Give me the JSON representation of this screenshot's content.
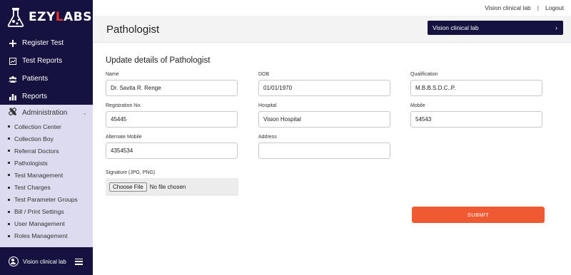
{
  "app": {
    "brand_prefix": "EZY",
    "brand_accent": "L",
    "brand_suffix": "ABS"
  },
  "sidebar": {
    "items": [
      {
        "label": "Register Test",
        "icon": "plus-icon"
      },
      {
        "label": "Test Reports",
        "icon": "report-icon"
      },
      {
        "label": "Patients",
        "icon": "users-icon"
      },
      {
        "label": "Reports",
        "icon": "bar-chart-icon"
      }
    ],
    "admin": {
      "label": "Administration",
      "icon": "tools-icon",
      "items": [
        "Collection Center",
        "Collection Boy",
        "Referral Doctors",
        "Pathologists",
        "Test Management",
        "Test Charges",
        "Test Parameter Groups",
        "Bill / Print Settings",
        "User Management",
        "Roles Management"
      ]
    },
    "footer": {
      "user": "Vision clinical lab"
    }
  },
  "topbar": {
    "lab": "Vision clinical lab",
    "separator": "|",
    "logout": "Logout"
  },
  "header": {
    "title": "Pathologist",
    "lab_selector": "Vision clinical lab",
    "lab_selector_chevron": "›"
  },
  "form": {
    "title": "Update details of Pathologist",
    "fields": {
      "name": {
        "label": "Name",
        "value": "Dr. Savita R. Renge"
      },
      "dob": {
        "label": "DOB",
        "value": "01/01/1970"
      },
      "qualification": {
        "label": "Qualification",
        "value": "M.B.B.S.D.C..P."
      },
      "registration": {
        "label": "Registration No.",
        "value": "45445"
      },
      "hospital": {
        "label": "Hospital",
        "value": "Vision Hospital"
      },
      "mobile": {
        "label": "Mobile",
        "value": "54543"
      },
      "alt_mobile": {
        "label": "Alternate Mobile",
        "value": "4354534"
      },
      "address": {
        "label": "Address",
        "value": ""
      }
    },
    "signature": {
      "label": "Signature (JPG, PNG)",
      "button": "Choose File",
      "status": "No file chosen"
    },
    "submit": "SUBMIT"
  },
  "colors": {
    "sidebar": "#15123f",
    "accent": "#e8322b",
    "submit": "#f05a33",
    "admin_panel": "#dcdbf0"
  }
}
